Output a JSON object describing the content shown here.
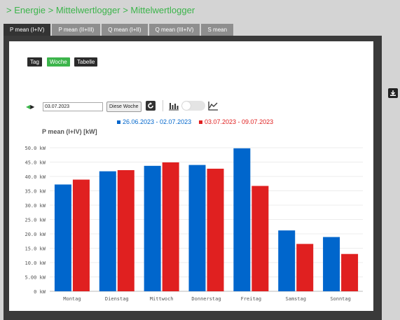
{
  "breadcrumb": "> Energie > Mittelwertlogger > Mittelwertlogger",
  "tabs": [
    {
      "label": "P mean (I+IV)"
    },
    {
      "label": "P mean (II+III)"
    },
    {
      "label": "Q mean (I+II)"
    },
    {
      "label": "Q mean (III+IV)"
    },
    {
      "label": "S mean"
    }
  ],
  "view_buttons": {
    "day": "Tag",
    "week": "Woche",
    "table": "Tabelle"
  },
  "controls": {
    "date": "03.07.2023",
    "this_week": "Diese Woche"
  },
  "colors": {
    "accent": "#3cb44b",
    "series1": "#0066cc",
    "series2": "#e02020"
  },
  "chart_data": {
    "type": "bar",
    "ylabel": "P mean (I+IV) [kW]",
    "categories": [
      "Montag",
      "Dienstag",
      "Mittwoch",
      "Donnerstag",
      "Freitag",
      "Samstag",
      "Sonntag"
    ],
    "ylim": [
      0,
      50
    ],
    "ytick_labels": [
      "0 kW",
      "5.00 kW",
      "10.0 kW",
      "15.0 kW",
      "20.0 kW",
      "25.0 kW",
      "30.0 kW",
      "35.0 kW",
      "40.0 kW",
      "45.0 kW",
      "50.0 kW"
    ],
    "grid": true,
    "legend_position": "top-center",
    "series": [
      {
        "name": "26.06.2023 - 02.07.2023",
        "color": "#0066cc",
        "values": [
          37.2,
          41.8,
          43.7,
          44.0,
          49.8,
          21.2,
          18.9
        ]
      },
      {
        "name": "03.07.2023 - 09.07.2023",
        "color": "#e02020",
        "values": [
          38.9,
          42.2,
          44.9,
          42.7,
          36.7,
          16.5,
          13.0
        ]
      }
    ]
  }
}
